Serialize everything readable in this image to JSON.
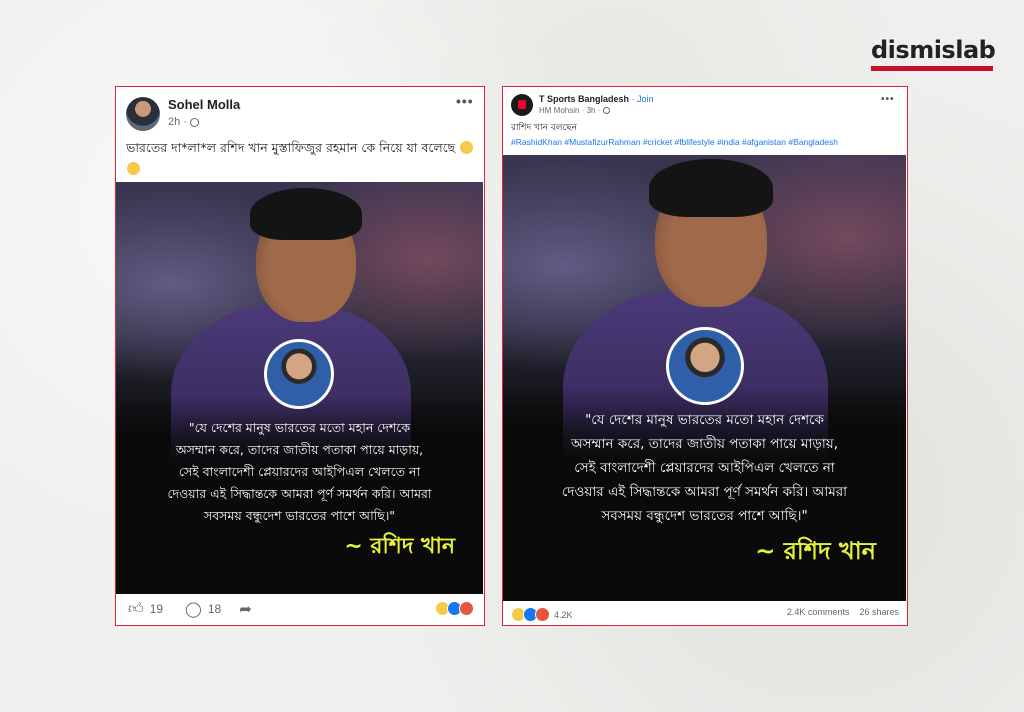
{
  "brand": {
    "logo_text": "dismislab"
  },
  "post_left": {
    "author": "Sohel Molla",
    "time": "2h ·",
    "caption": "ভারতের দা*লা*ল রশিদ খান মুস্তাফিজুর রহমান কে নিয়ে যা বলেছে",
    "likes": "19",
    "comments": "18",
    "quote": [
      "\"যে দেশের মানুষ ভারতের মতো মহান দেশকে",
      "অসম্মান করে, তাদের জাতীয় পতাকা পায়ে মাড়ায়,",
      "সেই বাংলাদেশী প্লেয়ারদের আইপিএল খেলতে না",
      "দেওয়ার এই সিদ্ধান্তকে আমরা পূর্ণ সমর্থন করি। আমরা",
      "সবসময় বন্ধুদেশ ভারতের পাশে আছি।\""
    ],
    "signature": "~ রশিদ খান"
  },
  "post_right": {
    "page_name": "T Sports Bangladesh",
    "join_label": "· Join",
    "meta": "HM Mohsin · 3h ·",
    "caption": "রাশিদ খান বলছেন",
    "hashtags": "#RashidKhan #MustafizurRahman #cricket #fblifestyle #india #afganistan #Bangladesh",
    "reaction_count": "4.2K",
    "comments": "2.4K comments",
    "shares": "26 shares",
    "quote": [
      "\"যে দেশের মানুষ ভারতের মতো মহান দেশকে",
      "অসম্মান করে, তাদের জাতীয় পতাকা পায়ে মাড়ায়,",
      "সেই বাংলাদেশী প্লেয়ারদের আইপিএল খেলতে না",
      "দেওয়ার এই সিদ্ধান্তকে আমরা পূর্ণ সমর্থন করি। আমরা",
      "সবসময় বন্ধুদেশ ভারতের পাশে আছি।\""
    ],
    "signature": "~ রশিদ খান"
  },
  "icons": {
    "more": "more-options-icon",
    "like": "like-icon",
    "comment": "comment-icon",
    "share": "share-icon",
    "globe": "globe-icon"
  },
  "colors": {
    "accent": "#c8102e",
    "signature": "#e6f23a",
    "link": "#1877f2"
  }
}
